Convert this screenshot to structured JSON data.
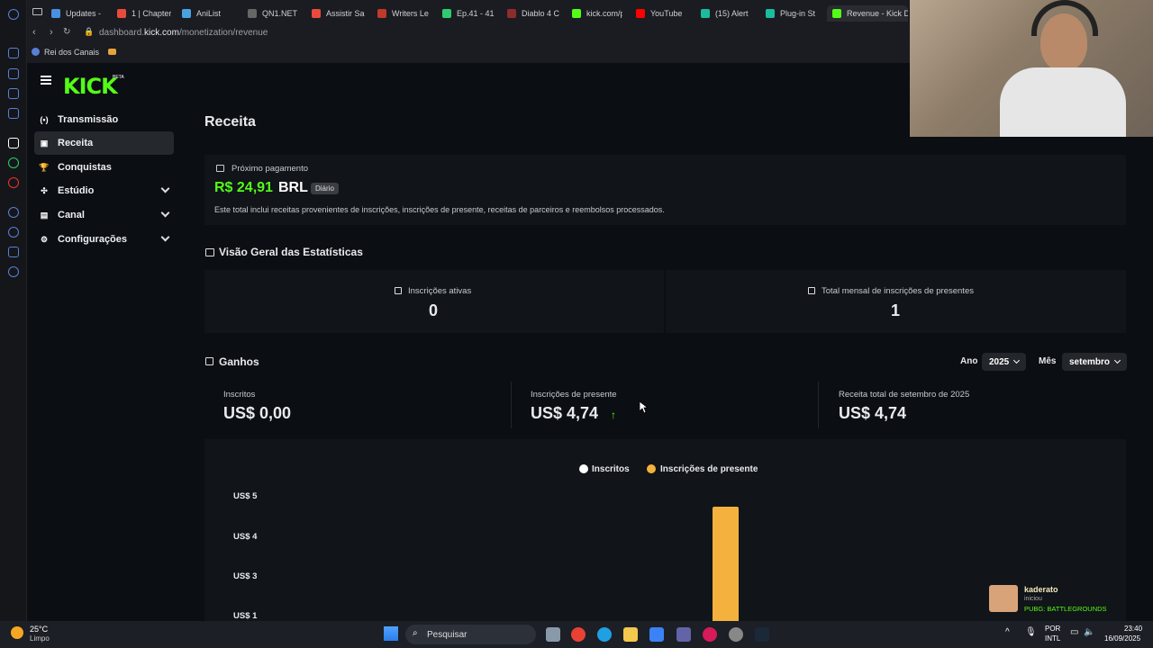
{
  "browser": {
    "tabs": [
      {
        "label": "Updates -",
        "color": "#4a90e2"
      },
      {
        "label": "1 | Chapter",
        "color": "#e84b3c"
      },
      {
        "label": "AniList",
        "color": "#4aa3df"
      },
      {
        "label": "QN1.NET",
        "color": "#666666"
      },
      {
        "label": "Assistir Sa",
        "color": "#e84b3c"
      },
      {
        "label": "Writers Le",
        "color": "#c0392b"
      },
      {
        "label": "Ep.41 - 41",
        "color": "#2ecc71"
      },
      {
        "label": "Diablo 4 C",
        "color": "#8e2c2c"
      },
      {
        "label": "kick.com/p",
        "color": "#53fc18"
      },
      {
        "label": "YouTube",
        "color": "#ff0000"
      },
      {
        "label": "(15) Alert",
        "color": "#1abc9c"
      },
      {
        "label": "Plug-in St",
        "color": "#1abc9c"
      },
      {
        "label": "Revenue - Kick Das",
        "color": "#53fc18"
      }
    ],
    "url_prefix": "dashboard.",
    "url_domain": "kick.com",
    "url_path": "/monetization/revenue",
    "bookmark": "Rei dos Canais"
  },
  "kick": {
    "logo": "KICK",
    "logo_badge": "BETA",
    "sidebar": [
      {
        "label": "Transmissão",
        "icon": "broadcast-icon",
        "glyph": "(•)"
      },
      {
        "label": "Receita",
        "icon": "revenue-icon",
        "glyph": "▣"
      },
      {
        "label": "Conquistas",
        "icon": "trophy-icon",
        "glyph": "🏆"
      },
      {
        "label": "Estúdio",
        "icon": "studio-icon",
        "glyph": "✣"
      },
      {
        "label": "Canal",
        "icon": "channel-icon",
        "glyph": "▤"
      },
      {
        "label": "Configurações",
        "icon": "gear-icon",
        "glyph": "⚙"
      }
    ],
    "page_title": "Receita",
    "payout": {
      "label": "Próximo pagamento",
      "amount": "R$ 24,91",
      "currency": "BRL",
      "badge": "Diário",
      "description": "Este total inclui receitas provenientes de inscrições, inscrições de presente, receitas de parceiros e reembolsos processados."
    },
    "stats_overview": {
      "title": "Visão Geral das Estatísticas",
      "active_subs_label": "Inscrições ativas",
      "active_subs_value": "0",
      "gift_subs_label": "Total mensal de inscrições de presentes",
      "gift_subs_value": "1"
    },
    "earnings": {
      "title": "Ganhos",
      "year_label": "Ano",
      "year_value": "2025",
      "month_label": "Mês",
      "month_value": "setembro",
      "cards": [
        {
          "label": "Inscritos",
          "value": "US$ 0,00"
        },
        {
          "label": "Inscrições de presente",
          "value": "US$ 4,74"
        },
        {
          "label": "Receita total de setembro de 2025",
          "value": "US$ 4,74"
        }
      ]
    }
  },
  "chart_data": {
    "type": "bar",
    "series": [
      {
        "name": "Inscritos",
        "color": "#ffffff",
        "values": [
          0
        ]
      },
      {
        "name": "Inscrições de presente",
        "color": "#f5b13d",
        "values": [
          4.74
        ]
      }
    ],
    "y_ticks": [
      "US$ 5",
      "US$ 4",
      "US$ 3",
      "US$ 1"
    ],
    "ylim": [
      0,
      5
    ]
  },
  "notification": {
    "user": "kaderato",
    "action": "iniciou",
    "game": "PUBG: BATTLEGROUNDS"
  },
  "taskbar": {
    "weather_temp": "25°C",
    "weather_desc": "Limpo",
    "search_placeholder": "Pesquisar",
    "lang1": "POR",
    "lang2": "INTL",
    "time": "23:40",
    "date": "16/09/2025"
  }
}
